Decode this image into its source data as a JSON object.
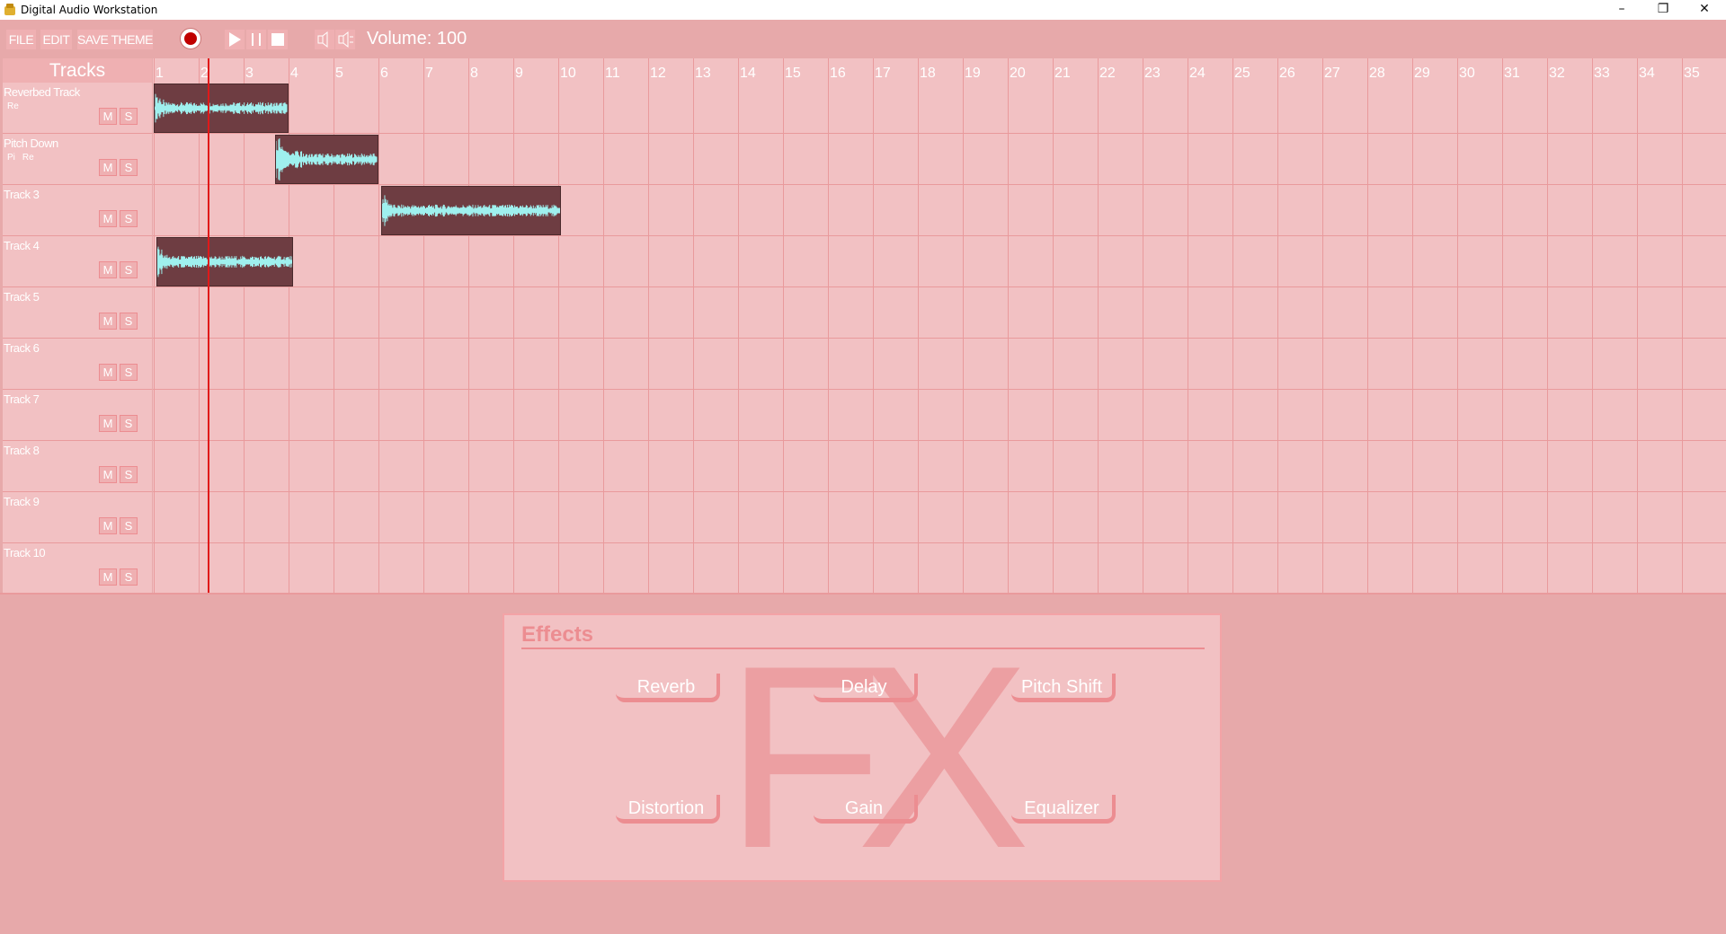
{
  "window": {
    "title": "Digital Audio Workstation",
    "controls": [
      "–",
      "❐",
      "✕"
    ]
  },
  "menu": {
    "file": "FILE",
    "edit": "EDIT",
    "save_theme": "SAVE THEME"
  },
  "transport": {
    "volume_label": "Volume: 100"
  },
  "tracks_header": "Tracks",
  "ruler_ticks": [
    "1",
    "2",
    "3",
    "4",
    "5",
    "6",
    "7",
    "8",
    "9",
    "10",
    "11",
    "12",
    "13",
    "14",
    "15",
    "16",
    "17",
    "18",
    "19",
    "20",
    "21",
    "22",
    "23",
    "24",
    "25",
    "26",
    "27",
    "28",
    "29",
    "30",
    "31",
    "32",
    "33",
    "34",
    "35"
  ],
  "tracks": [
    {
      "name": "Reverbed Track",
      "effects": [
        "Re"
      ]
    },
    {
      "name": "Pitch Down",
      "effects": [
        "Pi",
        "Re"
      ]
    },
    {
      "name": "Track 3",
      "effects": []
    },
    {
      "name": "Track 4",
      "effects": []
    },
    {
      "name": "Track 5",
      "effects": []
    },
    {
      "name": "Track 6",
      "effects": []
    },
    {
      "name": "Track 7",
      "effects": []
    },
    {
      "name": "Track 8",
      "effects": []
    },
    {
      "name": "Track 9",
      "effects": []
    },
    {
      "name": "Track 10",
      "effects": []
    }
  ],
  "track_buttons": {
    "mute": "M",
    "solo": "S"
  },
  "clips": [
    {
      "track": 1,
      "start_beat": 1.0,
      "end_beat": 4.0
    },
    {
      "track": 2,
      "start_beat": 3.7,
      "end_beat": 6.0
    },
    {
      "track": 3,
      "start_beat": 6.05,
      "end_beat": 10.05
    },
    {
      "track": 4,
      "start_beat": 1.05,
      "end_beat": 4.1
    }
  ],
  "playhead_beat": 2.2,
  "effects": {
    "title": "Effects",
    "logo_text": "FX",
    "buttons": [
      "Reverb",
      "Delay",
      "Pitch Shift",
      "Distortion",
      "Gain",
      "Equalizer"
    ]
  },
  "colors": {
    "background": "#e7a9aa",
    "panel": "#f2c1c3",
    "accent": "#ec8d91",
    "clip": "#6e3d42",
    "waveform": "#9ff0ee",
    "playhead": "#e01919"
  }
}
